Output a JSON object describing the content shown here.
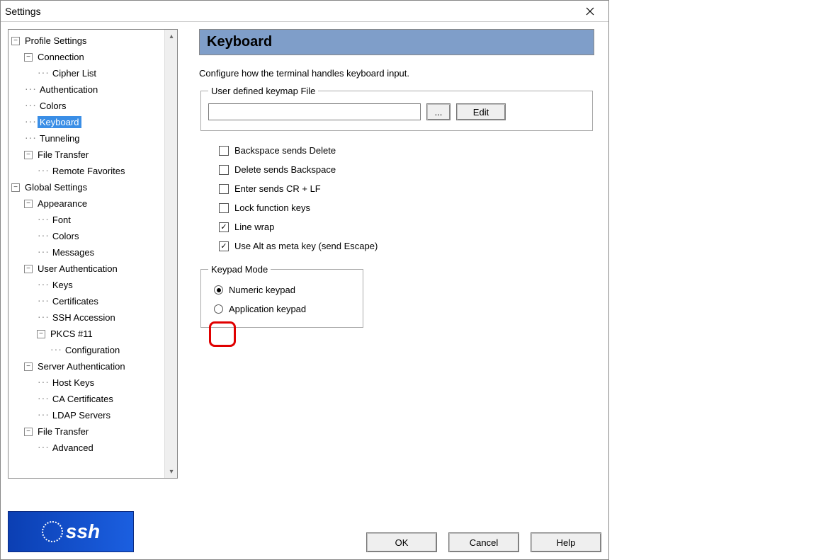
{
  "window": {
    "title": "Settings"
  },
  "tree": {
    "profile": "Profile Settings",
    "connection": "Connection",
    "cipherList": "Cipher List",
    "authentication": "Authentication",
    "colors": "Colors",
    "keyboard": "Keyboard",
    "tunneling": "Tunneling",
    "fileTransfer": "File Transfer",
    "remoteFavorites": "Remote Favorites",
    "global": "Global Settings",
    "appearance": "Appearance",
    "font": "Font",
    "gcolors": "Colors",
    "messages": "Messages",
    "userAuth": "User Authentication",
    "keys": "Keys",
    "certificates": "Certificates",
    "sshAccession": "SSH Accession",
    "pkcs11": "PKCS #11",
    "configuration": "Configuration",
    "serverAuth": "Server Authentication",
    "hostKeys": "Host Keys",
    "caCerts": "CA Certificates",
    "ldap": "LDAP Servers",
    "gFileTransfer": "File Transfer",
    "advanced": "Advanced"
  },
  "pane": {
    "header": "Keyboard",
    "desc": "Configure how the terminal handles keyboard input.",
    "keymapGroup": "User defined keymap File",
    "keymapValue": "",
    "browse": "...",
    "edit": "Edit",
    "checks": {
      "bsDel": "Backspace sends Delete",
      "delBs": "Delete sends Backspace",
      "crlf": "Enter sends CR + LF",
      "lockFn": "Lock function keys",
      "lineWrap": "Line wrap",
      "altMeta": "Use Alt as meta key (send Escape)"
    },
    "keypadGroup": "Keypad Mode",
    "radioNumeric": "Numeric keypad",
    "radioApp": "Application keypad"
  },
  "buttons": {
    "ok": "OK",
    "cancel": "Cancel",
    "help": "Help"
  },
  "logo": "ssh"
}
